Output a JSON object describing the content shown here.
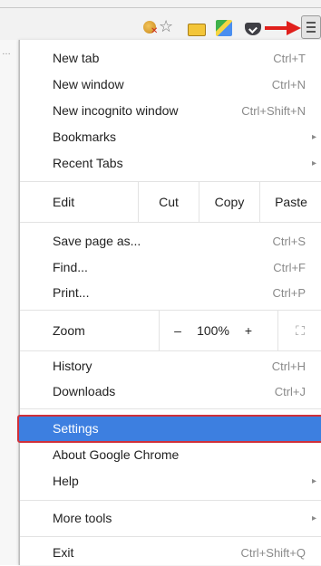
{
  "menu": {
    "group1": [
      {
        "label": "New tab",
        "shortcut": "Ctrl+T"
      },
      {
        "label": "New window",
        "shortcut": "Ctrl+N"
      },
      {
        "label": "New incognito window",
        "shortcut": "Ctrl+Shift+N"
      },
      {
        "label": "Bookmarks",
        "submenu": "▸"
      },
      {
        "label": "Recent Tabs",
        "submenu": "▸"
      }
    ],
    "edit": {
      "label": "Edit",
      "cut": "Cut",
      "copy": "Copy",
      "paste": "Paste"
    },
    "group2": [
      {
        "label": "Save page as...",
        "shortcut": "Ctrl+S"
      },
      {
        "label": "Find...",
        "shortcut": "Ctrl+F"
      },
      {
        "label": "Print...",
        "shortcut": "Ctrl+P"
      }
    ],
    "zoom": {
      "label": "Zoom",
      "minus": "–",
      "value": "100%",
      "plus": "+",
      "fullscreen": "⛶"
    },
    "group3": [
      {
        "label": "History",
        "shortcut": "Ctrl+H"
      },
      {
        "label": "Downloads",
        "shortcut": "Ctrl+J"
      }
    ],
    "group4": [
      {
        "label": "Settings"
      },
      {
        "label": "About Google Chrome"
      },
      {
        "label": "Help",
        "submenu": "▸"
      }
    ],
    "more_tools": {
      "label": "More tools",
      "submenu": "▸"
    },
    "exit": {
      "label": "Exit",
      "shortcut": "Ctrl+Shift+Q"
    }
  },
  "toolbar": {
    "star_glyph": "☆",
    "icons": [
      "cookie-extension-icon",
      "bookmark-star-icon",
      "ruler-extension-icon",
      "maps-extension-icon",
      "pocket-extension-icon",
      "chrome-menu-icon"
    ]
  },
  "colors": {
    "highlight": "#3d7fe0",
    "highlight_border": "#d0303a",
    "arrow": "#e0201c"
  }
}
